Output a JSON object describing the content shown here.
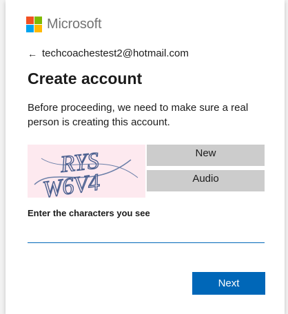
{
  "brand": {
    "name": "Microsoft",
    "logo_colors": [
      "#f25022",
      "#7fba00",
      "#00a4ef",
      "#ffb900"
    ]
  },
  "identity": {
    "back_icon": "←",
    "email": "techcoachestest2@hotmail.com"
  },
  "page": {
    "title": "Create account",
    "description": "Before proceeding, we need to make sure a real person is creating this account."
  },
  "captcha": {
    "image_text_line1": "RYS",
    "image_text_line2": "W6V4",
    "new_button_label": "New",
    "audio_button_label": "Audio",
    "prompt_label": "Enter the characters you see",
    "input_value": "",
    "input_placeholder": ""
  },
  "actions": {
    "next_label": "Next"
  },
  "colors": {
    "accent": "#0067b8",
    "captcha_bg": "#fde9ef",
    "captcha_button_bg": "#cccccc"
  }
}
